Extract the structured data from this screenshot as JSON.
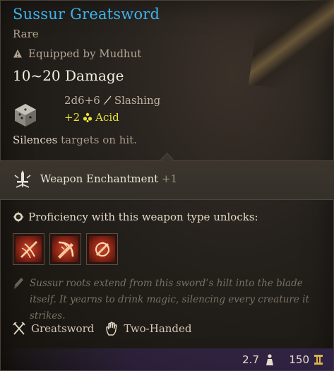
{
  "item": {
    "name": "Sussur Greatsword",
    "rarity": "Rare",
    "equipped": "Equipped by Mudhut",
    "damage": "10~20 Damage",
    "roll": "2d6+6",
    "roll_type": "Slashing",
    "bonus_value": "+2",
    "bonus_type": "Acid",
    "passive_keyword": "Silences",
    "passive_text": " targets on hit.",
    "enchant_label": "Weapon Enchantment",
    "enchant_value": "+1",
    "proficiency_text": "Proficiency with this weapon type unlocks:",
    "actions": [
      {
        "icon": "cleave-icon"
      },
      {
        "icon": "lacerate-icon"
      },
      {
        "icon": "pommel-strike-icon"
      }
    ],
    "lore": "Sussur roots extend from this sword’s hilt into the blade itself. It yearns to drink magic, silencing every creature it strikes.",
    "properties": [
      {
        "label": "Greatsword",
        "icon": "crossed-swords-icon"
      },
      {
        "label": "Two-Handed",
        "icon": "open-hand-icon"
      }
    ],
    "weight": "2.7",
    "price": "150"
  },
  "colors": {
    "title": "#3db4ee",
    "acid": "#e9e23a",
    "action_bg": "#8a2416"
  }
}
